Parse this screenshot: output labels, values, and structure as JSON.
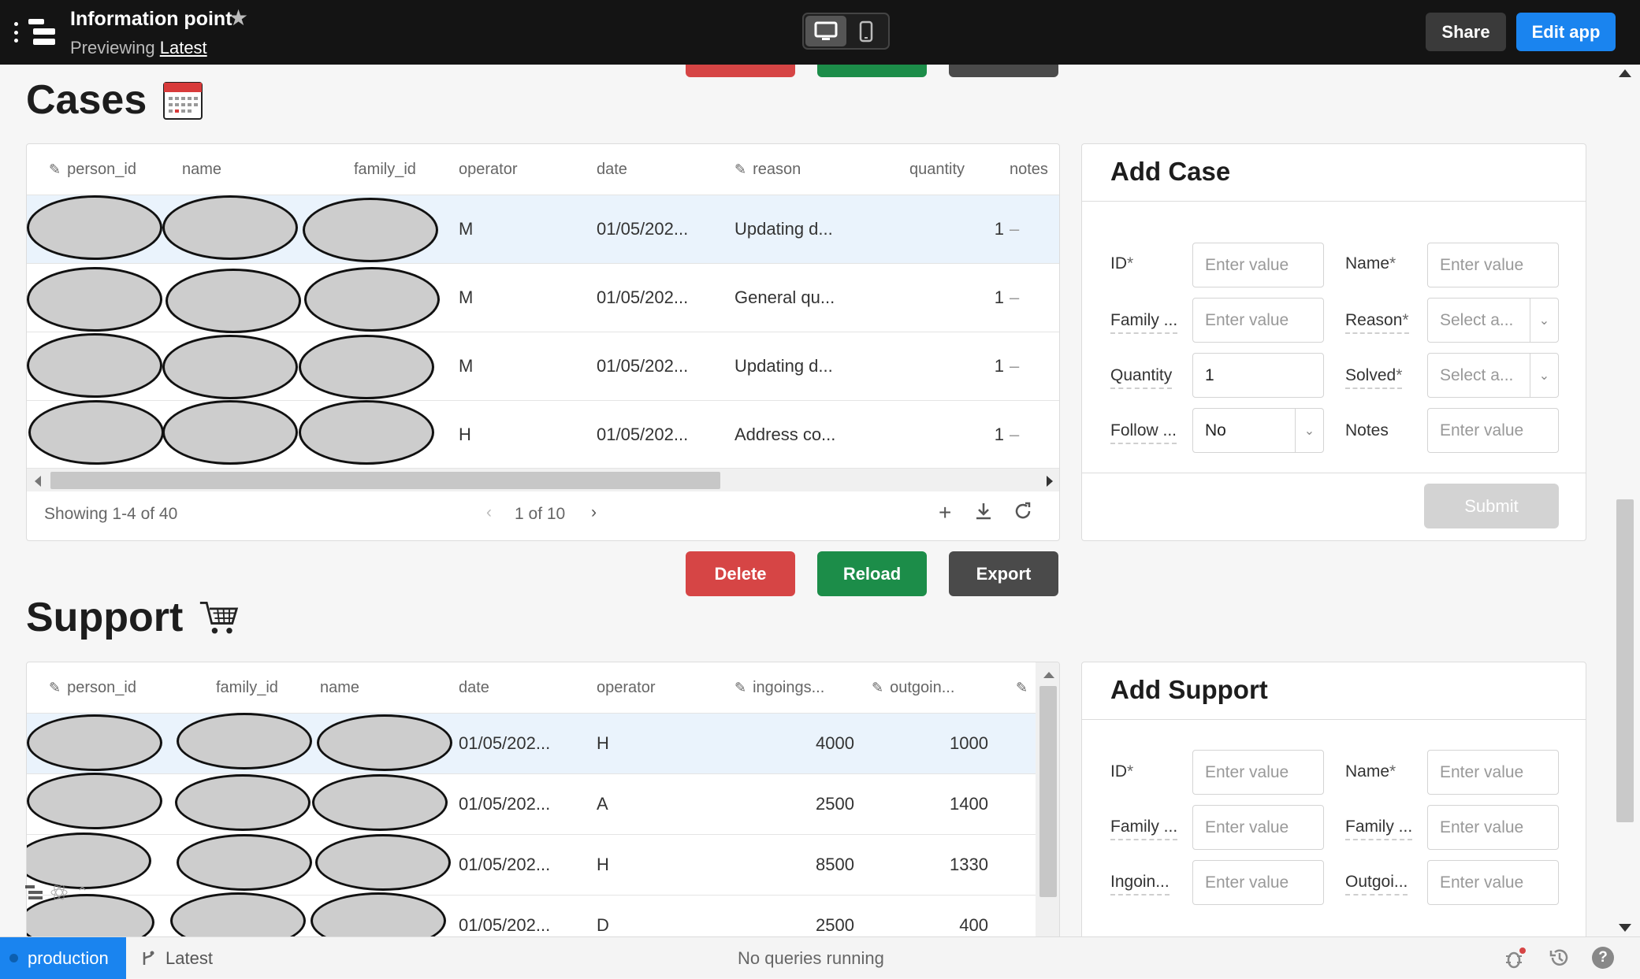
{
  "topbar": {
    "app_title": "Information point",
    "previewing_label": "Previewing",
    "previewing_version": "Latest",
    "share_label": "Share",
    "edit_label": "Edit app"
  },
  "cases": {
    "title": "Cases",
    "title_icon": "calendar-icon",
    "columns": [
      "person_id",
      "name",
      "family_id",
      "operator",
      "date",
      "reason",
      "quantity",
      "notes"
    ],
    "editable_columns": [
      "person_id",
      "reason"
    ],
    "rows": [
      {
        "operator": "M",
        "date": "01/05/202...",
        "reason": "Updating d...",
        "quantity": "1",
        "notes": "–"
      },
      {
        "operator": "M",
        "date": "01/05/202...",
        "reason": "General qu...",
        "quantity": "1",
        "notes": "–"
      },
      {
        "operator": "M",
        "date": "01/05/202...",
        "reason": "Updating d...",
        "quantity": "1",
        "notes": "–"
      },
      {
        "operator": "H",
        "date": "01/05/202...",
        "reason": "Address co...",
        "quantity": "1",
        "notes": "–"
      }
    ],
    "showing": "Showing 1-4 of 40",
    "page": "1 of 10",
    "buttons": {
      "delete": "Delete",
      "reload": "Reload",
      "export": "Export"
    }
  },
  "add_case": {
    "title": "Add Case",
    "fields": {
      "id_label": "ID",
      "name_label": "Name",
      "family_label": "Family ...",
      "reason_label": "Reason",
      "quantity_label": "Quantity",
      "solved_label": "Solved",
      "follow_label": "Follow ...",
      "notes_label": "Notes",
      "placeholder": "Enter value",
      "select_placeholder": "Select a...",
      "quantity_value": "1",
      "follow_value": "No"
    },
    "submit_label": "Submit"
  },
  "support": {
    "title": "Support",
    "title_icon": "shopping-cart-icon",
    "columns": [
      "person_id",
      "family_id",
      "name",
      "date",
      "operator",
      "ingoings...",
      "outgoin..."
    ],
    "editable_columns": [
      "person_id",
      "ingoings...",
      "outgoin..."
    ],
    "rows": [
      {
        "date": "01/05/202...",
        "operator": "H",
        "ingoings": "4000",
        "outgoings": "1000"
      },
      {
        "date": "01/05/202...",
        "operator": "A",
        "ingoings": "2500",
        "outgoings": "1400"
      },
      {
        "date": "01/05/202...",
        "operator": "H",
        "ingoings": "8500",
        "outgoings": "1330"
      },
      {
        "date": "01/05/202...",
        "operator": "D",
        "ingoings": "2500",
        "outgoings": "400"
      }
    ]
  },
  "add_support": {
    "title": "Add Support",
    "fields": {
      "id_label": "ID",
      "name_label": "Name",
      "family1_label": "Family ...",
      "family2_label": "Family ...",
      "ingoin_label": "Ingoin...",
      "outgoi_label": "Outgoi...",
      "placeholder": "Enter value"
    }
  },
  "statusbar": {
    "environment": "production",
    "version": "Latest",
    "queries": "No queries running"
  },
  "colors": {
    "accent": "#1a84ef",
    "delete": "#d64545",
    "reload": "#1c8d49",
    "export": "#4a4a4a",
    "topbar": "#141414"
  }
}
